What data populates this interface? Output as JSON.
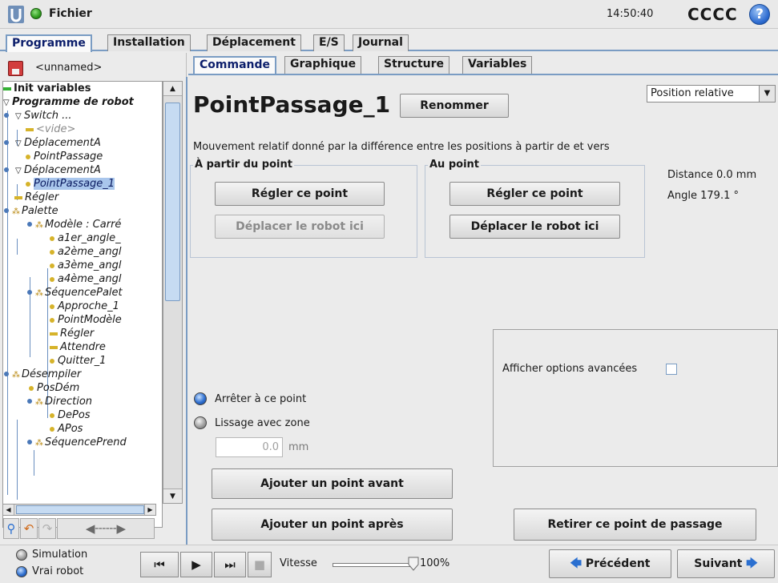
{
  "topbar": {
    "menu_label": "Fichier",
    "time": "14:50:40",
    "user": "CCCC",
    "help_glyph": "?"
  },
  "main_tabs": [
    {
      "label": "Programme",
      "active": true
    },
    {
      "label": "Installation",
      "active": false
    },
    {
      "label": "Déplacement",
      "active": false
    },
    {
      "label": "E/S",
      "active": false
    },
    {
      "label": "Journal",
      "active": false
    }
  ],
  "program": {
    "name": "<unnamed>"
  },
  "tree": [
    {
      "label": "Init variables",
      "style": "bold",
      "icon": "dash-green"
    },
    {
      "label": "Programme de robot",
      "style": "bold-italic",
      "icon": "triangle-down"
    },
    {
      "label": "Switch ...",
      "style": "italic",
      "icon": "triangle-down"
    },
    {
      "label": "<vide>",
      "style": "grey-italic",
      "icon": "dash"
    },
    {
      "label": "DéplacementA",
      "style": "italic",
      "icon": "triangle-down"
    },
    {
      "label": "PointPassage",
      "style": "italic",
      "icon": "dot"
    },
    {
      "label": "DéplacementA",
      "style": "italic",
      "icon": "triangle-down"
    },
    {
      "label": "PointPassage_1",
      "style": "italic",
      "icon": "dot",
      "selected": true
    },
    {
      "label": "Régler",
      "style": "italic",
      "icon": "dash"
    },
    {
      "label": "Palette",
      "style": "italic",
      "icon": "pallet"
    },
    {
      "label": "Modèle : Carré",
      "style": "italic",
      "icon": "pallet"
    },
    {
      "label": "a1er_angle_",
      "style": "italic",
      "icon": "dot"
    },
    {
      "label": "a2ème_angl",
      "style": "italic",
      "icon": "dot"
    },
    {
      "label": "a3ème_angl",
      "style": "italic",
      "icon": "dot"
    },
    {
      "label": "a4ème_angl",
      "style": "italic",
      "icon": "dot"
    },
    {
      "label": "SéquencePalet",
      "style": "italic",
      "icon": "pallet"
    },
    {
      "label": "Approche_1",
      "style": "italic",
      "icon": "dot"
    },
    {
      "label": "PointModèle",
      "style": "italic",
      "icon": "dot"
    },
    {
      "label": "Régler",
      "style": "italic",
      "icon": "dash"
    },
    {
      "label": "Attendre",
      "style": "italic",
      "icon": "dash"
    },
    {
      "label": "Quitter_1",
      "style": "italic",
      "icon": "dot"
    },
    {
      "label": "Désempiler",
      "style": "italic",
      "icon": "pallet"
    },
    {
      "label": "PosDém",
      "style": "italic",
      "icon": "dot"
    },
    {
      "label": "Direction",
      "style": "italic",
      "icon": "pallet"
    },
    {
      "label": "DePos",
      "style": "italic",
      "icon": "dot"
    },
    {
      "label": "APos",
      "style": "italic",
      "icon": "dot"
    },
    {
      "label": "SéquencePrend",
      "style": "italic",
      "icon": "pallet"
    }
  ],
  "sub_tabs": [
    {
      "label": "Commande",
      "active": true
    },
    {
      "label": "Graphique",
      "active": false
    },
    {
      "label": "Structure",
      "active": false
    },
    {
      "label": "Variables",
      "active": false
    }
  ],
  "waypoint": {
    "title": "PointPassage_1",
    "rename_label": "Renommer",
    "mode_selected": "Position relative",
    "description": "Mouvement relatif donné par la différence entre les positions à partir de et vers",
    "from_group": {
      "legend": "À partir du point",
      "set_label": "Régler ce point",
      "move_label": "Déplacer le robot ici"
    },
    "to_group": {
      "legend": "Au point",
      "set_label": "Régler ce point",
      "move_label": "Déplacer le robot ici"
    },
    "distance_text": "Distance 0.0 mm",
    "angle_text": "Angle 179.1 °",
    "advanced_label": "Afficher options avancées",
    "stop_label": "Arrêter à ce point",
    "blend_label": "Lissage avec zone",
    "blend_value": "0.0",
    "blend_unit": "mm",
    "add_before_label": "Ajouter un point avant",
    "add_after_label": "Ajouter un point après",
    "remove_label": "Retirer ce point de passage"
  },
  "bottombar": {
    "simulation_label": "Simulation",
    "real_robot_label": "Vrai robot",
    "speed_label": "Vitesse",
    "speed_value": "100%",
    "speed_fraction": 1.0,
    "prev_label": "Précédent",
    "next_label": "Suivant"
  },
  "colors": {
    "accent": "#7a9cc3",
    "title_blue": "#0c1e6b",
    "selection": "#a9c6ec"
  }
}
